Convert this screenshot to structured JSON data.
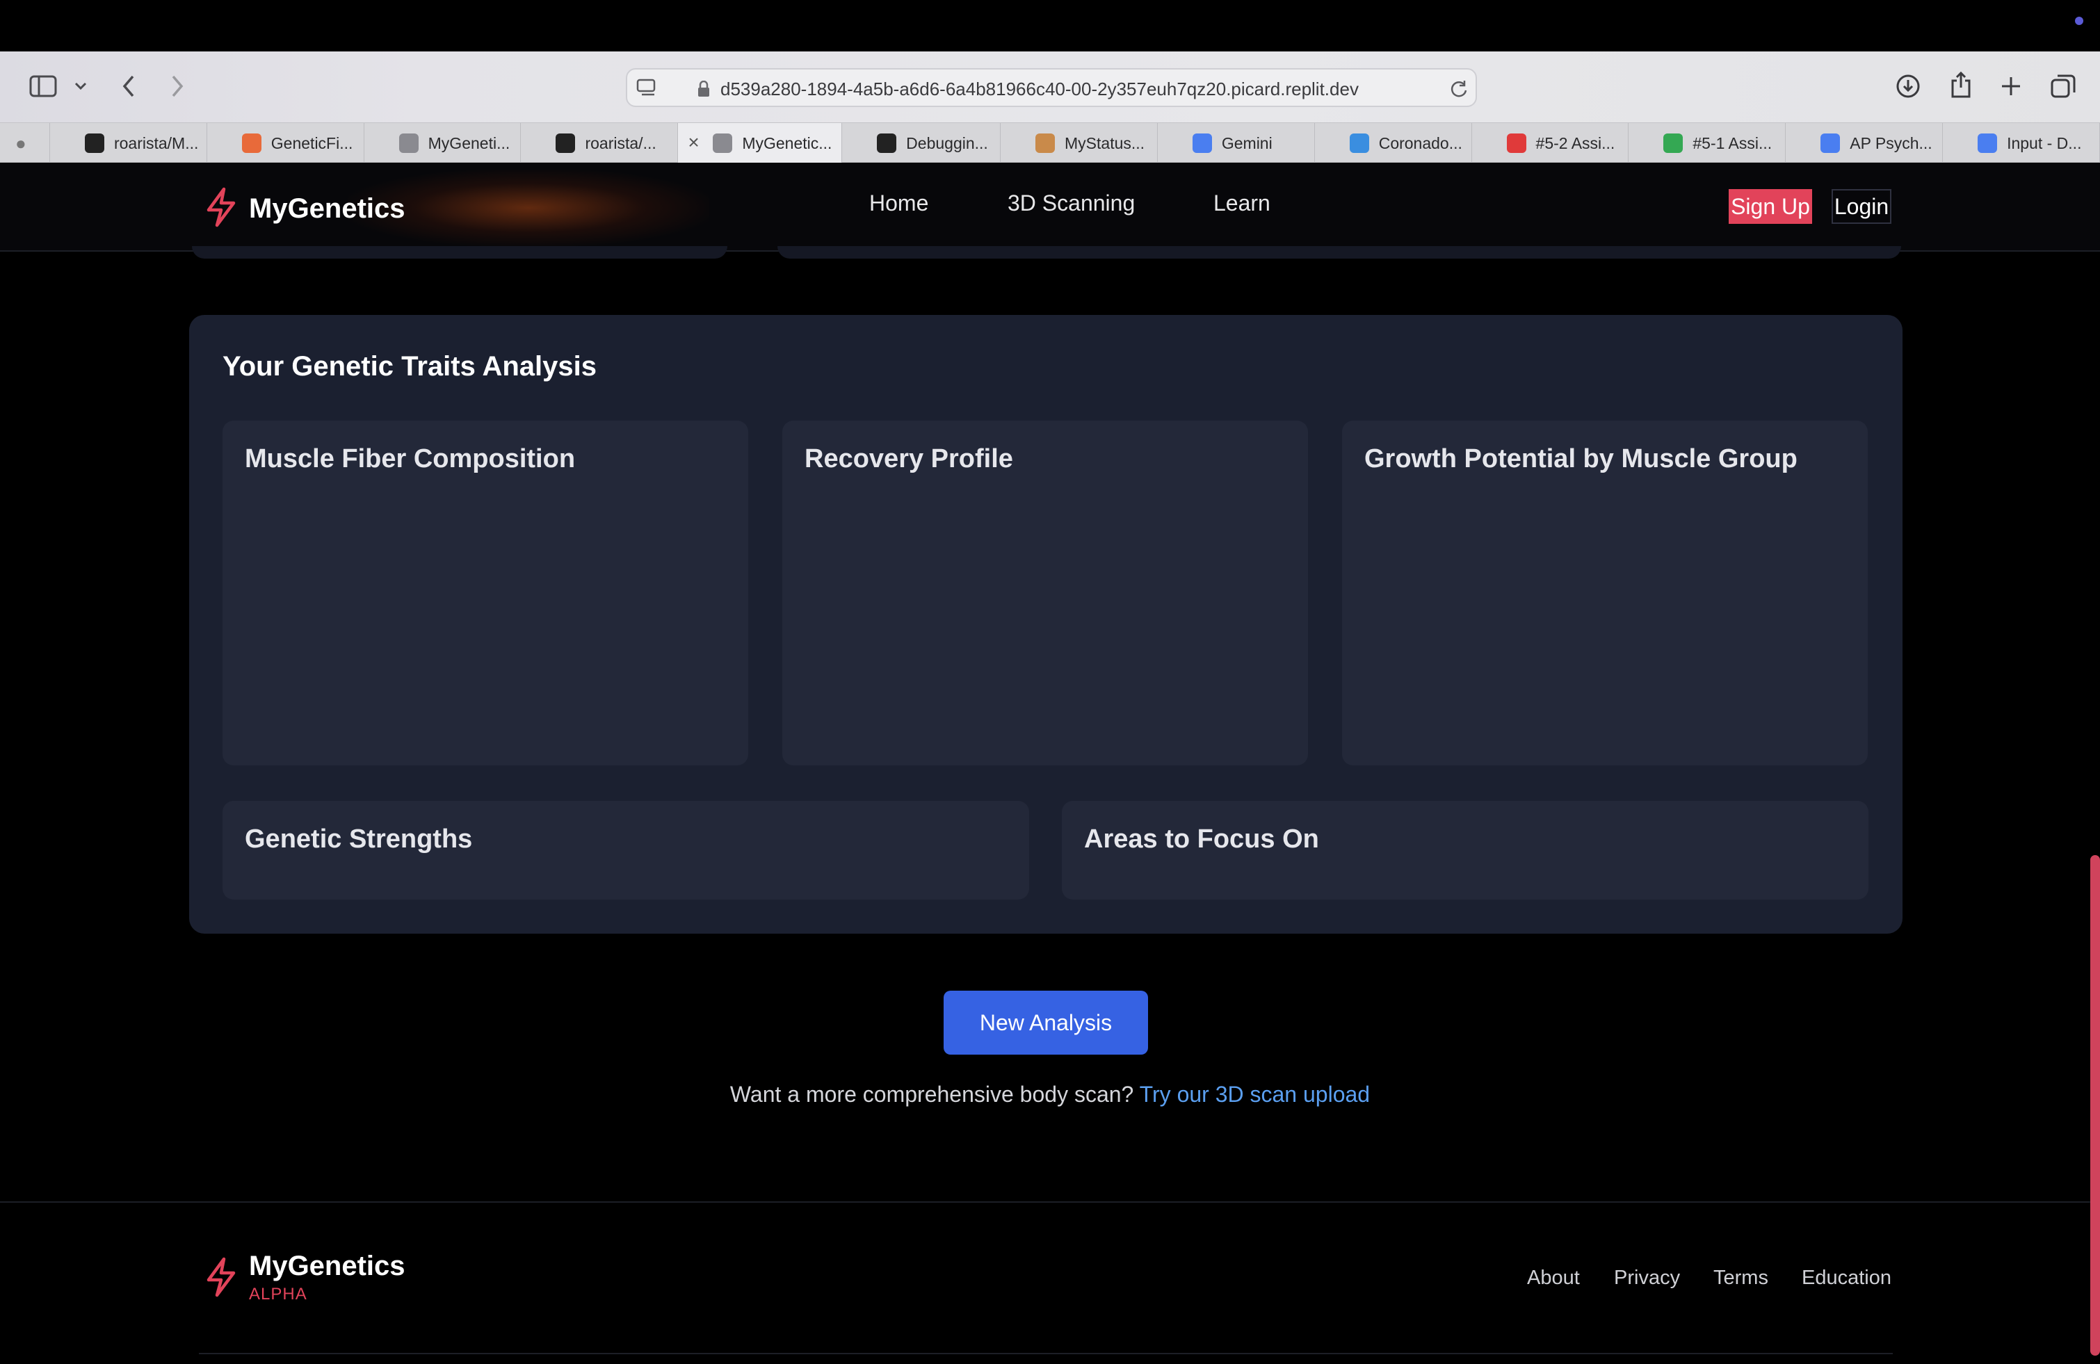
{
  "browser": {
    "url": "d539a280-1894-4a5b-a6d6-6a4b81966c40-00-2y357euh7qz20.picard.replit.dev",
    "tabs": [
      {
        "label": "roarista/M...",
        "icon": "github-icon",
        "color": "#222222"
      },
      {
        "label": "GeneticFi...",
        "icon": "figma-like-icon",
        "color": "#e86a3a"
      },
      {
        "label": "MyGeneti...",
        "icon": "replit-r-icon",
        "color": "#8a8a90"
      },
      {
        "label": "roarista/...",
        "icon": "github-icon",
        "color": "#222222"
      },
      {
        "label": "MyGenetic...",
        "icon": "replit-r-icon",
        "color": "#8a8a90",
        "active": true
      },
      {
        "label": "Debuggin...",
        "icon": "chatgpt-icon",
        "color": "#222222"
      },
      {
        "label": "MyStatus...",
        "icon": "shield-icon",
        "color": "#c98a4a"
      },
      {
        "label": "Gemini",
        "icon": "gemini-icon",
        "color": "#4a7ef0"
      },
      {
        "label": "Coronado...",
        "icon": "cloud-icon",
        "color": "#3a8ee0"
      },
      {
        "label": "#5-2 Assi...",
        "icon": "canvas-icon",
        "color": "#e03a3a"
      },
      {
        "label": "#5-1 Assi...",
        "icon": "drive-icon",
        "color": "#34a853"
      },
      {
        "label": "AP Psych...",
        "icon": "docs-icon",
        "color": "#4a7ef0"
      },
      {
        "label": "Input - D...",
        "icon": "docs-icon",
        "color": "#4a7ef0"
      }
    ]
  },
  "nav": {
    "brand": "MyGenetics",
    "links": [
      "Home",
      "3D Scanning",
      "Learn"
    ],
    "signup": "Sign Up",
    "login": "Login"
  },
  "analysis": {
    "title": "Your Genetic Traits Analysis",
    "cards_top": [
      "Muscle Fiber Composition",
      "Recovery Profile",
      "Growth Potential by Muscle Group"
    ],
    "cards_bottom": [
      "Genetic Strengths",
      "Areas to Focus On"
    ]
  },
  "actions": {
    "new_analysis": "New Analysis",
    "cta_text": "Want a more comprehensive body scan?",
    "cta_link": "Try our 3D scan upload"
  },
  "footer": {
    "brand": "MyGenetics",
    "tag": "ALPHA",
    "links": [
      "About",
      "Privacy",
      "Terms",
      "Education"
    ]
  },
  "colors": {
    "accent": "#e2435a",
    "primary_button": "#3662e3",
    "link": "#5b9ff0",
    "panel": "#1b2030",
    "card": "#232839"
  }
}
